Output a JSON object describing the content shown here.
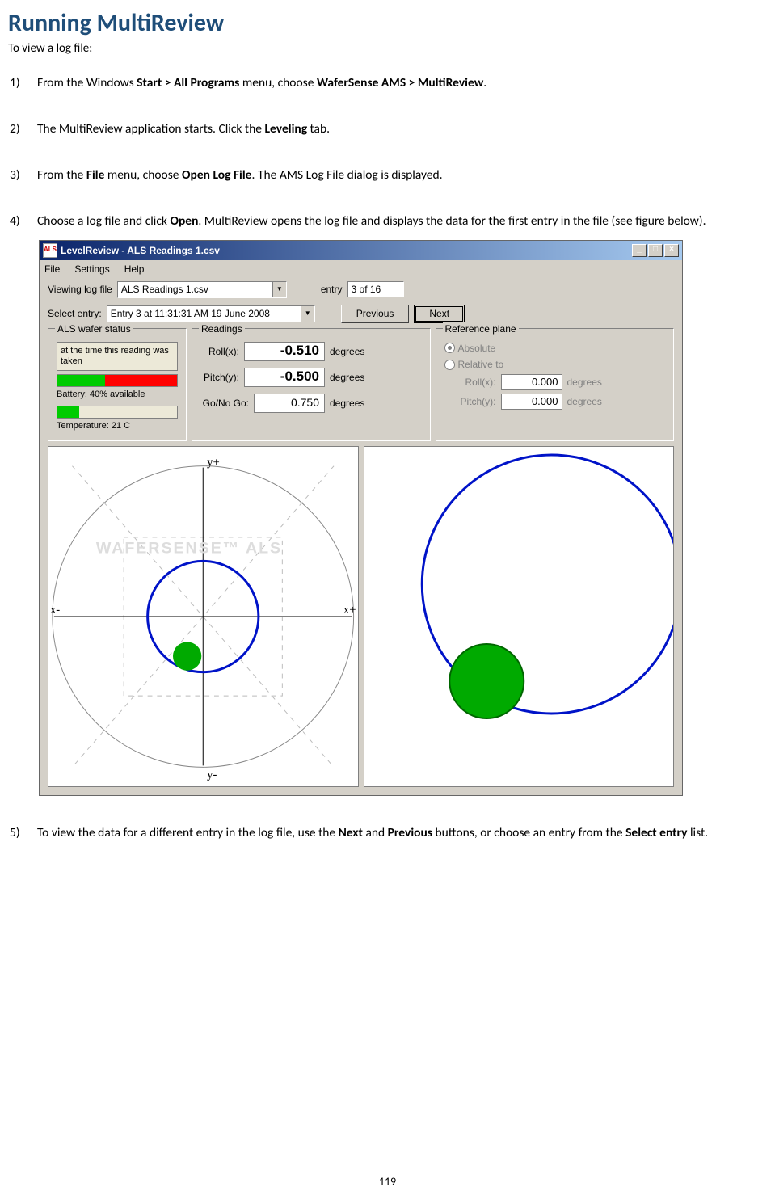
{
  "heading": "Running MultiReview",
  "intro": "To view a log file:",
  "steps": {
    "s1": {
      "t1": "From the Windows ",
      "b1": "Start > All Programs",
      "t2": " menu, choose ",
      "b2": "WaferSense AMS > MultiReview",
      "t3": "."
    },
    "s2": {
      "t1": "The MultiReview application starts. Click the ",
      "b1": "Leveling",
      "t2": " tab."
    },
    "s3": {
      "t1": "From the ",
      "b1": "File",
      "t2": " menu, choose ",
      "b2": "Open Log File",
      "t3": ". The AMS Log File dialog is displayed."
    },
    "s4": {
      "t1": "Choose a log file and click ",
      "b1": "Open",
      "t2": ". MultiReview opens the log file and displays the data for the first entry in the file (see figure below)."
    },
    "s5": {
      "t1": "To view the data for a different entry in the log file, use the ",
      "b1": "Next",
      "t2": " and ",
      "b2": "Previous",
      "t3": " buttons, or choose an entry from the ",
      "b3": "Select entry",
      "t4": " list."
    }
  },
  "figure": {
    "title": "LevelReview - ALS Readings 1.csv",
    "menu": {
      "file": "File",
      "settings": "Settings",
      "help": "Help"
    },
    "row1": {
      "label": "Viewing log file",
      "value": "ALS Readings 1.csv",
      "entry_label": "entry",
      "entry_value": "3 of 16"
    },
    "row2": {
      "label": "Select entry:",
      "value": "Entry 3 at 11:31:31 AM 19 June 2008",
      "prev": "Previous",
      "next": "Next"
    },
    "status": {
      "title": "ALS wafer status",
      "text": "at the time this reading was taken",
      "battery": "Battery: 40% available",
      "temperature": "Temperature: 21 C"
    },
    "readings": {
      "title": "Readings",
      "roll_label": "Roll(x):",
      "roll_value": "-0.510",
      "pitch_label": "Pitch(y):",
      "pitch_value": "-0.500",
      "gonogo_label": "Go/No Go:",
      "gonogo_value": "0.750",
      "unit": "degrees"
    },
    "reference": {
      "title": "Reference plane",
      "absolute": "Absolute",
      "relative": "Relative to",
      "roll_label": "Roll(x):",
      "roll_value": "0.000",
      "pitch_label": "Pitch(y):",
      "pitch_value": "0.000",
      "unit": "degrees"
    },
    "chart": {
      "watermark": "WAFERSENSE™ ALS",
      "yplus": "y+",
      "yminus": "y-",
      "xplus": "x+",
      "xminus": "x-"
    }
  },
  "page_number": "119"
}
